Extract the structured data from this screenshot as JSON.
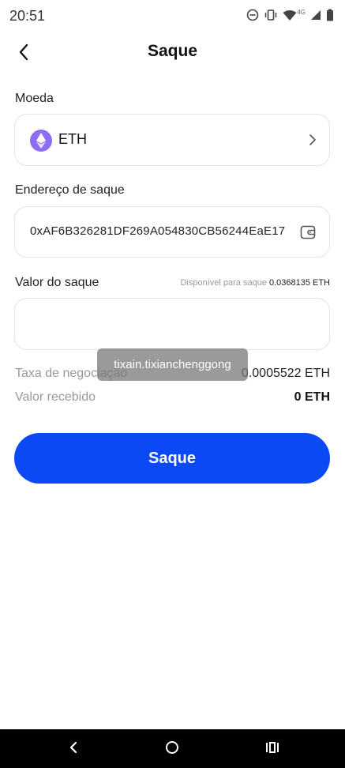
{
  "status_bar": {
    "time": "20:51",
    "network_label": "4G",
    "icons": [
      "do-not-disturb-icon",
      "vibrate-icon",
      "wifi-icon",
      "signal-icon",
      "battery-icon"
    ]
  },
  "header": {
    "title": "Saque",
    "back_icon": "chevron-left-icon"
  },
  "currency": {
    "label": "Moeda",
    "value": "ETH",
    "icon": "ethereum-icon",
    "icon_color": "#8e6ef0"
  },
  "address": {
    "label": "Endereço de saque",
    "value": "0xAF6B326281DF269A054830CB56244EaE17",
    "icon": "wallet-icon"
  },
  "amount": {
    "label": "Valor do saque",
    "available_label": "Disponível para saque",
    "available_value": "0.0368135 ETH",
    "value": ""
  },
  "fee": {
    "label": "Taxa de negociação",
    "value": "0.0005522 ETH"
  },
  "received": {
    "label": "Valor recebido",
    "value": "0 ETH"
  },
  "toast": {
    "text": "tixain.tixianchenggong"
  },
  "submit": {
    "label": "Saque",
    "color": "#0b49f4"
  },
  "nav_bar": {
    "icons": [
      "back-triangle-icon",
      "home-circle-icon",
      "recents-icon"
    ]
  }
}
